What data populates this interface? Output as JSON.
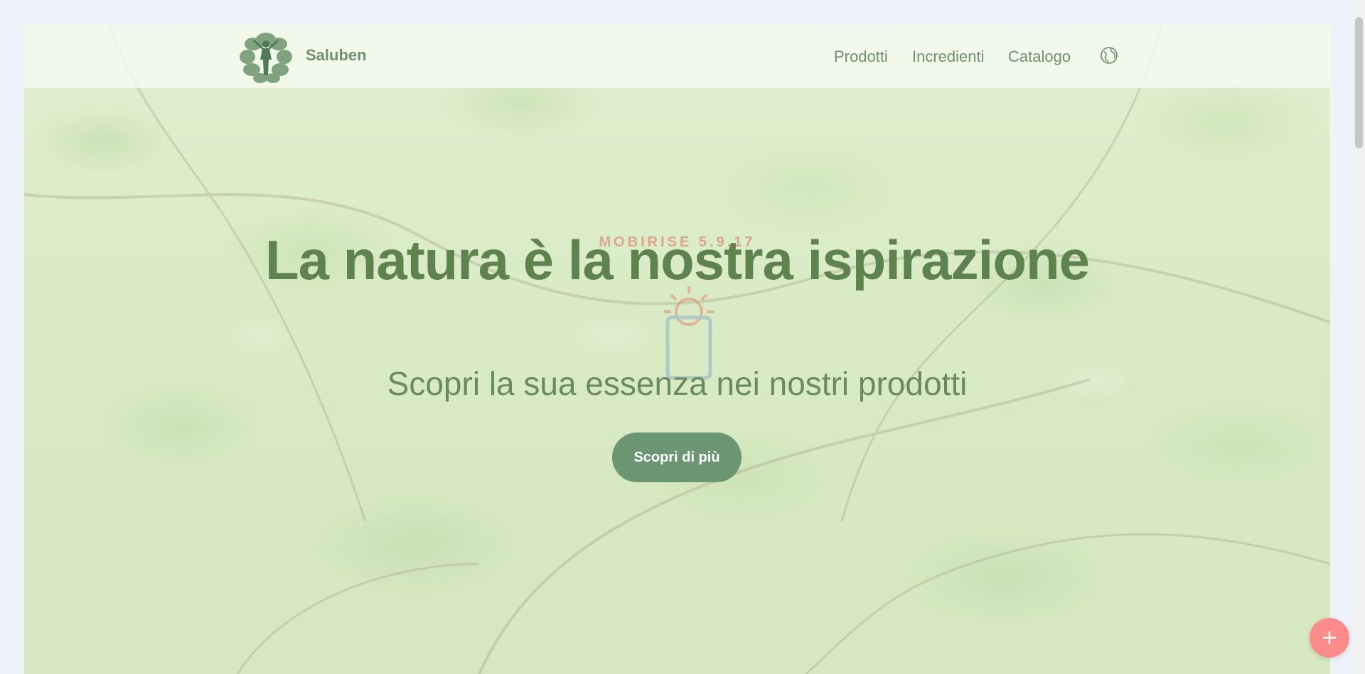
{
  "navbar": {
    "brand": "Saluben",
    "logo_icon": "tree-woman-logo-icon",
    "links": [
      "Prodotti",
      "Incredienti",
      "Catalogo"
    ],
    "globe_icon": "globe-icon"
  },
  "watermark": {
    "text": "MOBIRISE 5.9.17",
    "icon": "sun-phone-icon"
  },
  "hero": {
    "title": "La natura è la nostra ispirazione",
    "subtitle": "Scopri la sua essenza nei nostri prodotti",
    "cta_label": "Scopri di più"
  },
  "fab": {
    "icon": "plus-icon"
  },
  "colors": {
    "accent_green": "#6c9672",
    "title_green": "#5f834f",
    "fab_pink": "#ff8a8a"
  }
}
